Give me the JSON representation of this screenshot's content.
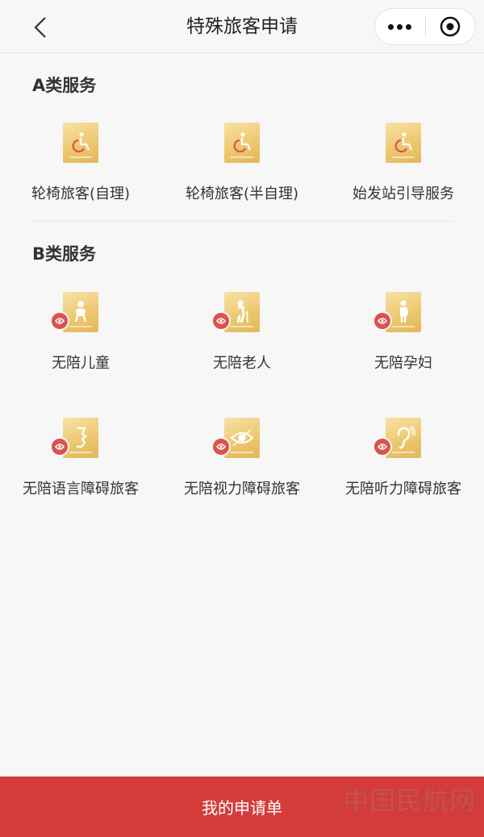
{
  "header": {
    "title": "特殊旅客申请",
    "back_icon": "chevron-left-icon",
    "more_icon": "more-dots-icon",
    "close_icon": "target-circle-icon"
  },
  "section_a": {
    "title": "A类服务",
    "items": [
      {
        "label": "轮椅旅客(自理)",
        "icon": "wheelchair-icon"
      },
      {
        "label": "轮椅旅客(半自理)",
        "icon": "wheelchair-icon"
      },
      {
        "label": "始发站引导服务",
        "icon": "wheelchair-icon"
      }
    ]
  },
  "section_b": {
    "title": "B类服务",
    "items": [
      {
        "label": "无陪儿童",
        "icon": "child-icon"
      },
      {
        "label": "无陪老人",
        "icon": "elderly-icon"
      },
      {
        "label": "无陪孕妇",
        "icon": "pregnant-woman-icon"
      },
      {
        "label": "无陪语言障碍旅客",
        "icon": "speech-impairment-icon"
      },
      {
        "label": "无陪视力障碍旅客",
        "icon": "visual-impairment-icon"
      },
      {
        "label": "无陪听力障碍旅客",
        "icon": "hearing-impairment-icon"
      }
    ]
  },
  "bottom_bar": {
    "button_label": "我的申请单",
    "watermark": "中国民航网"
  },
  "colors": {
    "accent_red": "#d43c3b",
    "tile_gold": "#ecc66c",
    "icon_red": "#d9534f"
  }
}
